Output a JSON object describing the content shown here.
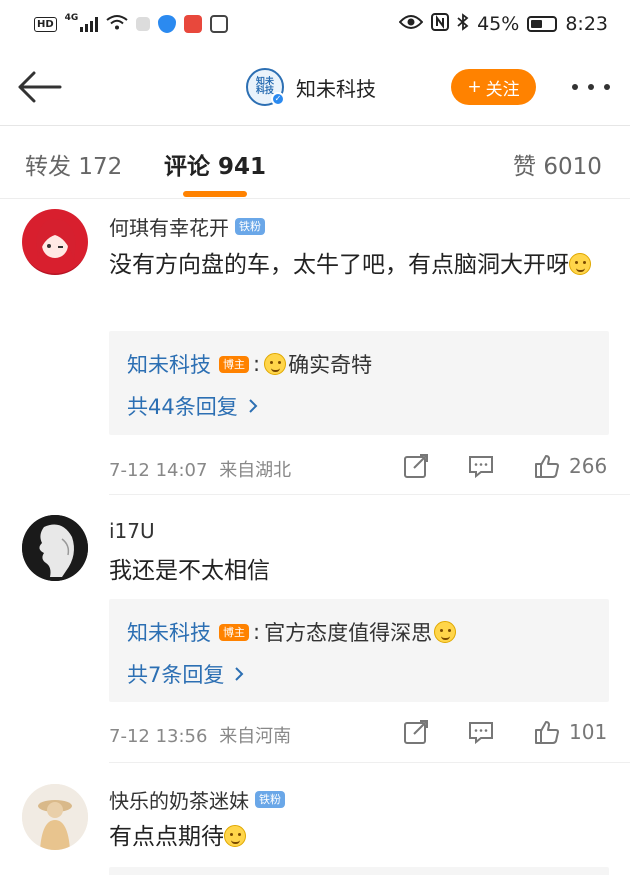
{
  "status_bar": {
    "hd": "HD",
    "network": "4G",
    "battery_pct": "45%",
    "time": "8:23"
  },
  "header": {
    "logo_text": "知未科技",
    "account_name": "知未科技",
    "follow_label": "关注",
    "follow_plus": "+"
  },
  "tabs": [
    {
      "label": "转发",
      "count": "172"
    },
    {
      "label": "评论",
      "count": "941"
    },
    {
      "label": "赞",
      "count": "6010"
    }
  ],
  "comments": [
    {
      "user": "何琪有幸花开",
      "badge": "铁粉",
      "text": "没有方向盘的车，太牛了吧，有点脑洞大开呀",
      "reply": {
        "author": "知未科技",
        "author_badge": "博主",
        "text": "确实奇特"
      },
      "reply_count_text": "共44条回复",
      "time": "7-12 14:07",
      "location": "来自湖北",
      "likes": "266"
    },
    {
      "user": "i17U",
      "badge": "",
      "text": "我还是不太相信",
      "reply": {
        "author": "知未科技",
        "author_badge": "博主",
        "text": "官方态度值得深思"
      },
      "reply_count_text": "共7条回复",
      "time": "7-12 13:56",
      "location": "来自河南",
      "likes": "101"
    },
    {
      "user": "快乐的奶茶迷妹",
      "badge": "铁粉",
      "text": "有点点期待"
    }
  ],
  "colors": {
    "accent": "#ff8200",
    "link": "#2c6fb3",
    "fan_badge": "#6aa7e8"
  }
}
